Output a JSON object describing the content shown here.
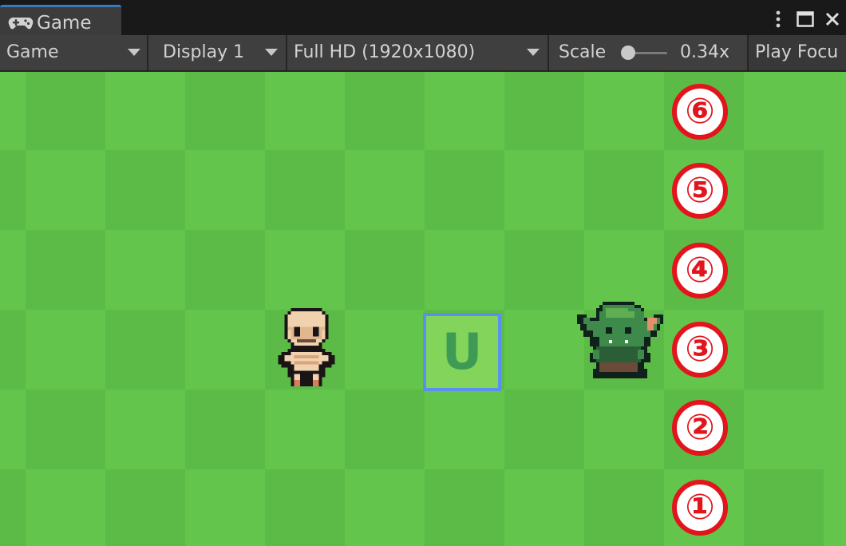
{
  "window": {
    "tab_label": "Game",
    "tab_icon": "gamepad-icon",
    "controls": [
      "more-icon",
      "maximize-icon",
      "close-icon"
    ]
  },
  "toolbar": {
    "view_mode": "Game",
    "display": "Display 1",
    "resolution": "Full HD (1920x1080)",
    "scale_label": "Scale",
    "scale_value": "0.34x",
    "play_focus": "Play Focu"
  },
  "scene": {
    "selected_tile_letter": "U",
    "characters": [
      "skeleton-sprite",
      "goblin-sprite"
    ],
    "markers": [
      "⑥",
      "⑤",
      "④",
      "③",
      "②",
      "①"
    ],
    "colors": {
      "grass_light": "#63c54b",
      "grass_dark": "#5cbb46",
      "selection_border": "#5a8ef0",
      "marker_red": "#e2141c"
    }
  }
}
